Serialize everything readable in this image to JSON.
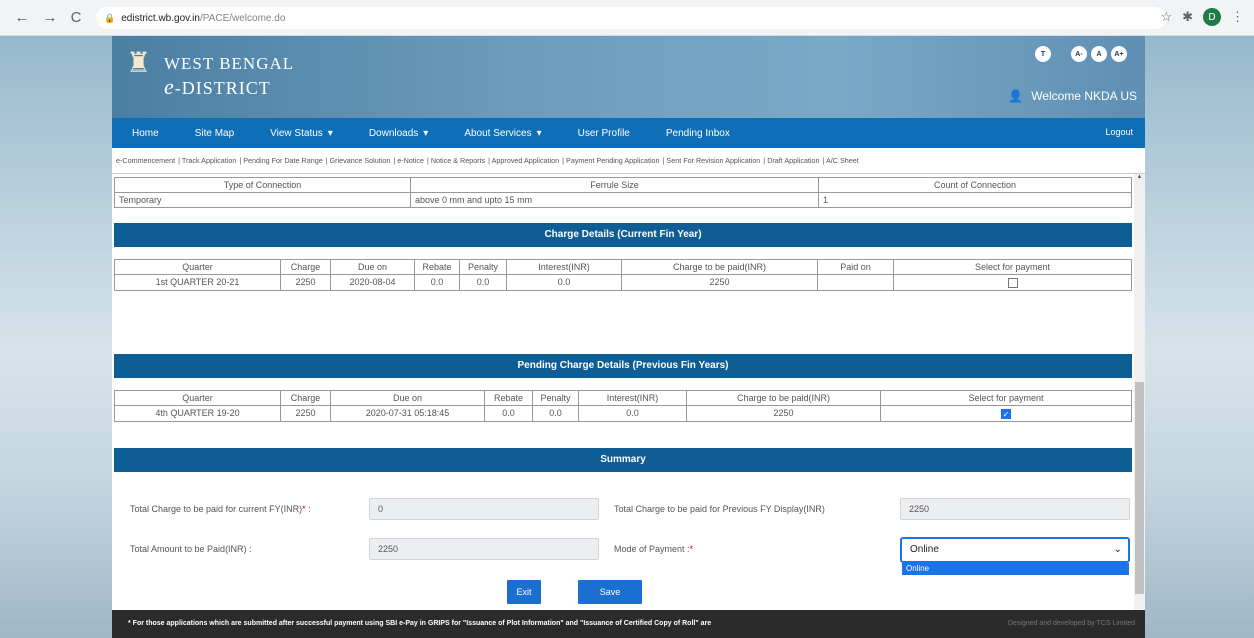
{
  "browser": {
    "back": "←",
    "forward": "→",
    "reload": "C",
    "url_domain": "edistrict.wb.gov.in",
    "url_path": "/PACE/welcome.do",
    "profile_initial": "D"
  },
  "header": {
    "logo_line1": "WEST BENGAL",
    "logo_e": "e",
    "logo_line2": "-DISTRICT",
    "icons": [
      "T",
      "A-",
      "A",
      "A+"
    ],
    "welcome": "Welcome NKDA US"
  },
  "nav": {
    "items": [
      {
        "label": "Home",
        "caret": ""
      },
      {
        "label": "Site Map",
        "caret": ""
      },
      {
        "label": "View Status",
        "caret": "▾"
      },
      {
        "label": "Downloads",
        "caret": "▾"
      },
      {
        "label": "About Services",
        "caret": "▾"
      },
      {
        "label": "User Profile",
        "caret": ""
      },
      {
        "label": "Pending Inbox",
        "caret": ""
      }
    ],
    "logout": "Logout"
  },
  "subnav": [
    "e-Commencement",
    "Track Application",
    "Pending For Date Range",
    "Grievance Solution",
    "e-Notice",
    "Notice & Reports",
    "Approved Application",
    "Payment Pending Application",
    "Sent For Revision Application",
    "Draft Application",
    "A/C Sheet"
  ],
  "connection": {
    "headers": [
      "Type of Connection",
      "Ferrule Size",
      "Count of Connection"
    ],
    "row": [
      "Temporary",
      "above 0 mm and upto 15 mm",
      "1"
    ]
  },
  "current_fy": {
    "title": "Charge Details (Current Fin Year)",
    "headers": [
      "Quarter",
      "Charge",
      "Due on",
      "Rebate",
      "Penalty",
      "Interest(INR)",
      "Charge to be paid(INR)",
      "Paid on",
      "Select for payment"
    ],
    "row": [
      "1st QUARTER 20-21",
      "2250",
      "2020-08-04",
      "0.0",
      "0.0",
      "0.0",
      "2250",
      ""
    ],
    "selected": false
  },
  "pending_fy": {
    "title": "Pending Charge Details (Previous Fin Years)",
    "headers": [
      "Quarter",
      "Charge",
      "Due on",
      "Rebate",
      "Penalty",
      "Interest(INR)",
      "Charge to be paid(INR)",
      "Select for payment"
    ],
    "row": [
      "4th QUARTER 19-20",
      "2250",
      "2020-07-31 05:18:45",
      "0.0",
      "0.0",
      "0.0",
      "2250"
    ],
    "selected": true
  },
  "summary": {
    "title": "Summary",
    "current_label": "Total Charge to be paid for current FY(INR)",
    "current_value": "0",
    "previous_label": "Total Charge to be paid for Previous FY Display(INR)",
    "previous_value": "2250",
    "total_label": "Total Amount to be Paid(INR) :",
    "total_value": "2250",
    "mode_label": "Mode of Payment :",
    "mode_value": "Online",
    "mode_option": "Online"
  },
  "buttons": {
    "exit": "Exit",
    "save": "Save"
  },
  "footer": {
    "notice": "* For those applications which are submitted after successful payment using SBI e-Pay in GRIPS for \"Issuance of Plot Information\" and \"Issuance of Certified Copy of Roll\" are",
    "credit": "Designed and developed by TCS Limited"
  },
  "colors": {
    "nav": "#0f6fb6",
    "section": "#0e5d94",
    "button": "#1a6fd1"
  }
}
